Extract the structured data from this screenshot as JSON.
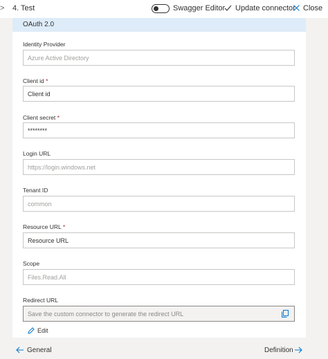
{
  "topbar": {
    "step_label": "4. Test",
    "swagger_editor_label": "Swagger Editor",
    "update_connector_label": "Update connector",
    "close_label": "Close",
    "accent_color": "#0078d4"
  },
  "panel": {
    "header": "OAuth 2.0",
    "fields": [
      {
        "label": "Identity Provider",
        "required": false,
        "value": "",
        "placeholder": "Azure Active Directory"
      },
      {
        "label": "Client id",
        "required": true,
        "value": "Client id",
        "placeholder": ""
      },
      {
        "label": "Client secret",
        "required": true,
        "value": "********",
        "placeholder": ""
      },
      {
        "label": "Login URL",
        "required": false,
        "value": "",
        "placeholder": "https://login.windows.net"
      },
      {
        "label": "Tenant ID",
        "required": false,
        "value": "",
        "placeholder": "common"
      },
      {
        "label": "Resource URL",
        "required": true,
        "value": "Resource URL",
        "placeholder": ""
      },
      {
        "label": "Scope",
        "required": false,
        "value": "",
        "placeholder": "Files.Read.All"
      },
      {
        "label": "Redirect URL",
        "required": false,
        "value": "",
        "placeholder": "Save the custom connector to generate the redirect URL"
      }
    ],
    "required_marker": "*",
    "edit_label": "Edit"
  },
  "footer": {
    "back_label": "General",
    "next_label": "Definition"
  }
}
